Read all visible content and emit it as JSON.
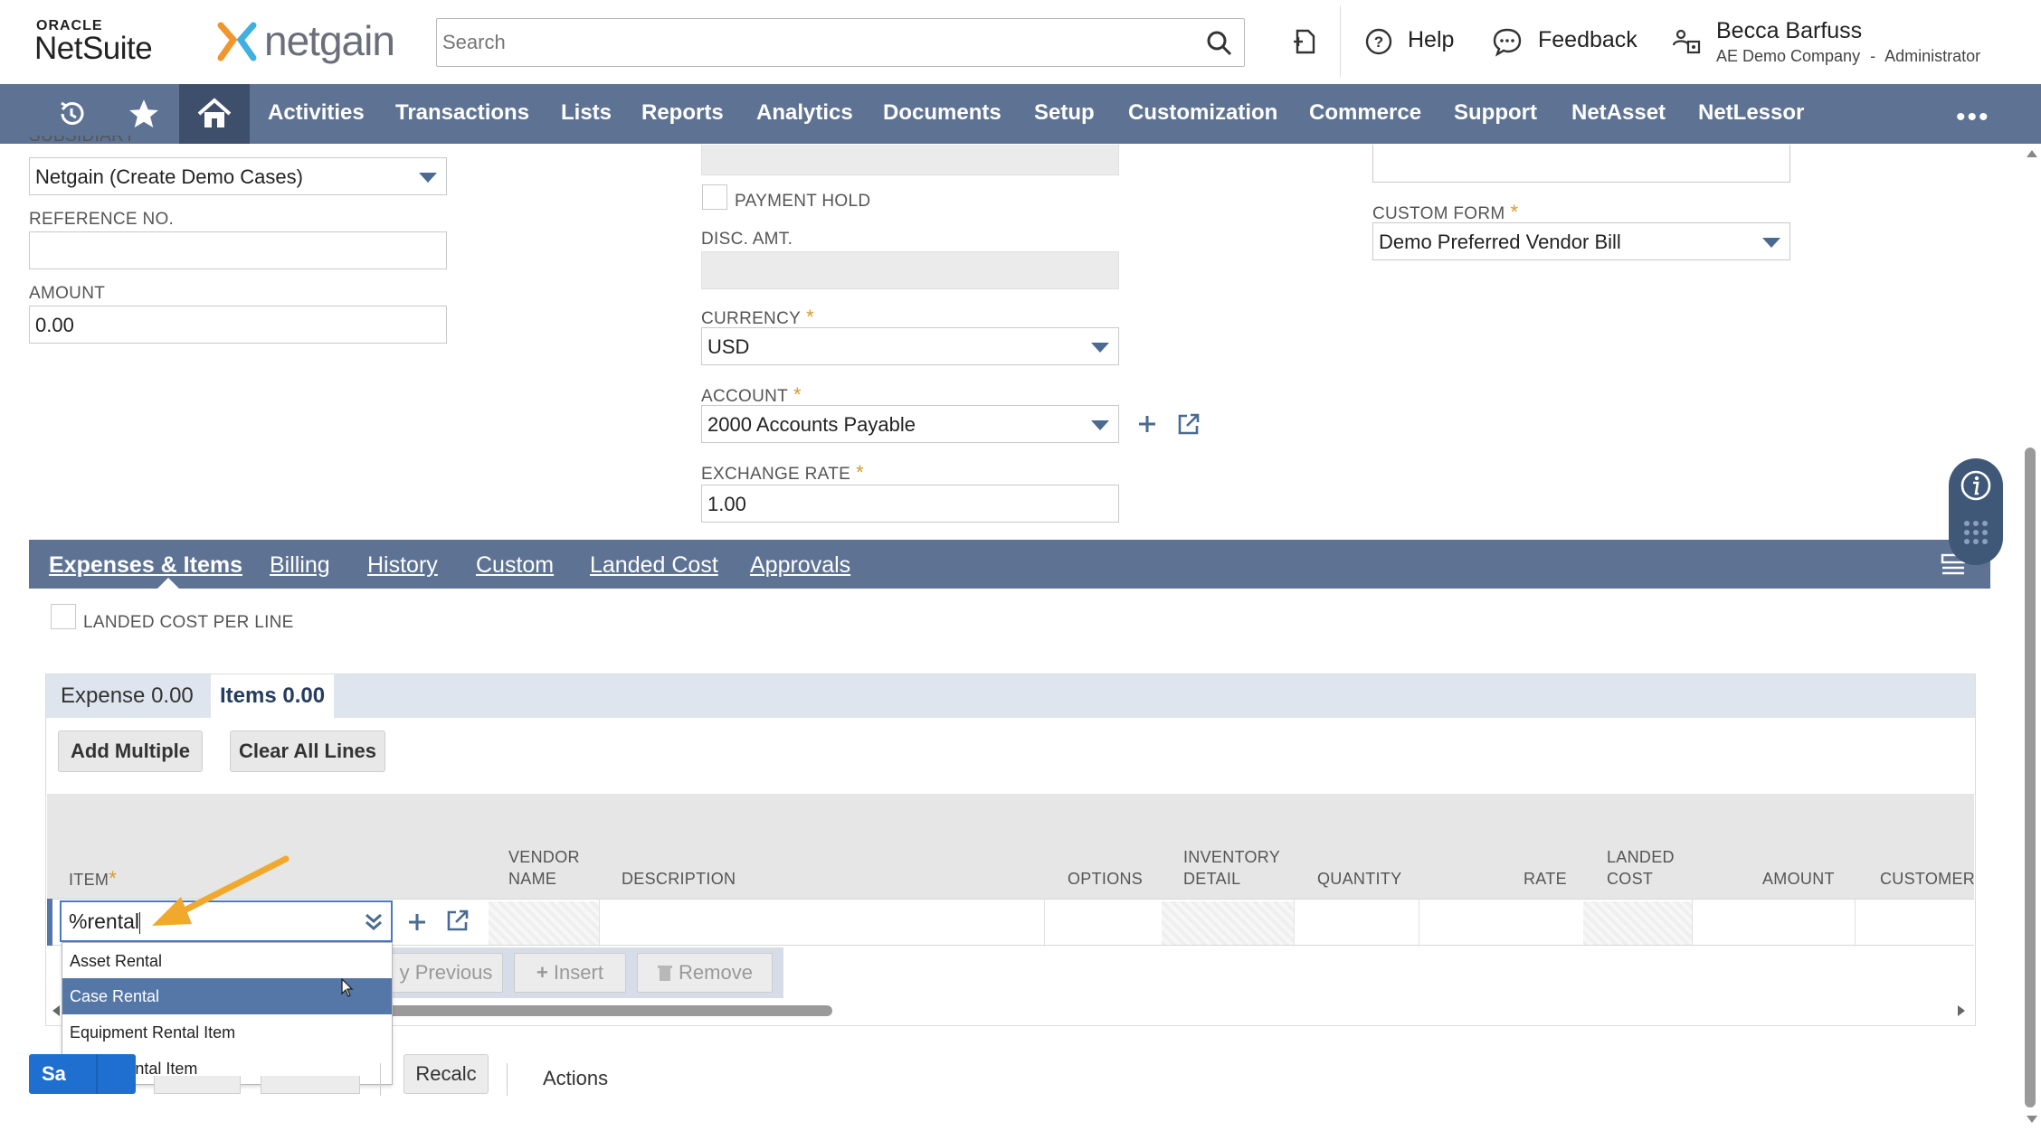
{
  "header": {
    "brand_top": "ORACLE",
    "brand_bottom": "NetSuite",
    "partner_logo_text": "netgain",
    "search_placeholder": "Search",
    "help_label": "Help",
    "feedback_label": "Feedback",
    "user_name": "Becca Barfuss",
    "user_company": "AE Demo Company",
    "user_role_sep": "-",
    "user_role": "Administrator"
  },
  "nav": {
    "items": [
      "Activities",
      "Transactions",
      "Lists",
      "Reports",
      "Analytics",
      "Documents",
      "Setup",
      "Customization",
      "Commerce",
      "Support",
      "NetAsset",
      "NetLessor"
    ],
    "more": "•••"
  },
  "form": {
    "subsidiary_label": "SUBSIDIARY",
    "subsidiary_value": "Netgain (Create Demo Cases)",
    "reference_label": "REFERENCE NO.",
    "reference_value": "",
    "amount_label": "AMOUNT",
    "amount_value": "0.00",
    "payment_hold_label": "PAYMENT HOLD",
    "disc_amt_label": "DISC. AMT.",
    "currency_label": "CURRENCY",
    "currency_value": "USD",
    "account_label": "ACCOUNT",
    "account_value": "2000 Accounts Payable",
    "exchange_rate_label": "EXCHANGE RATE",
    "exchange_rate_value": "1.00",
    "custom_form_label": "CUSTOM FORM",
    "custom_form_value": "Demo Preferred Vendor Bill",
    "required_mark": "*"
  },
  "tabs": [
    "Expenses & Items",
    "Billing",
    "History",
    "Custom",
    "Landed Cost",
    "Approvals"
  ],
  "landed_cost_per_line_label": "LANDED COST PER LINE",
  "subtabs": {
    "expense": "Expense 0.00",
    "items": "Items 0.00"
  },
  "buttons": {
    "add_multiple": "Add Multiple",
    "clear_all_lines": "Clear All Lines",
    "previous": "y Previous",
    "insert": "Insert",
    "remove": "Remove",
    "recalc": "Recalc",
    "save_partial": "Sa",
    "actions": "Actions"
  },
  "grid": {
    "columns": {
      "item": "ITEM",
      "vendor_name_1": "VENDOR",
      "vendor_name_2": "NAME",
      "description": "DESCRIPTION",
      "options": "OPTIONS",
      "inventory_1": "INVENTORY",
      "inventory_2": "DETAIL",
      "quantity": "QUANTITY",
      "rate": "RATE",
      "landed_1": "LANDED",
      "landed_2": "COST",
      "amount": "AMOUNT",
      "customer": "CUSTOMER"
    },
    "item_input_value": "%rental"
  },
  "dropdown": {
    "options": [
      "Asset Rental",
      "Case Rental",
      "Equipment Rental Item",
      "Truck Rental Item"
    ],
    "highlighted": "Case Rental"
  },
  "colors": {
    "nav_bg": "#5e7394",
    "accent_arrow": "#f0a92c",
    "highlight": "#5477a8",
    "save_blue": "#1f6fd1"
  }
}
